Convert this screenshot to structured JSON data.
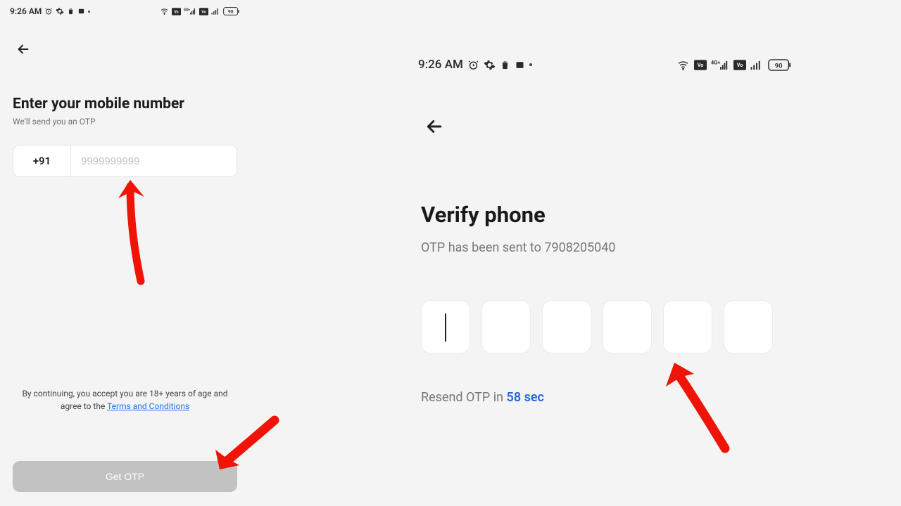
{
  "left": {
    "status": {
      "time": "9:26 AM",
      "battery": "90",
      "icons": [
        "alarm-icon",
        "gear-icon",
        "trash-icon",
        "card-icon",
        "dot"
      ],
      "right_icons": [
        "wifi-icon",
        "volte-icon",
        "signal-4g-icon",
        "volte-icon-2",
        "signal-icon",
        "battery-icon"
      ]
    },
    "title": "Enter your mobile number",
    "subtitle": "We'll send you an OTP",
    "country_code": "+91",
    "phone_placeholder": "9999999999",
    "terms_prefix": "By continuing, you accept you are 18+ years of age and agree to the ",
    "terms_link": "Terms and Conditions",
    "cta": "Get OTP"
  },
  "right": {
    "status": {
      "time": "9:26 AM",
      "battery": "90",
      "icons": [
        "alarm-icon",
        "gear-icon",
        "trash-icon",
        "card-icon",
        "dot"
      ],
      "right_icons": [
        "wifi-icon",
        "volte-icon",
        "signal-4g-icon",
        "volte-icon-2",
        "signal-icon",
        "battery-icon"
      ]
    },
    "title": "Verify phone",
    "subtitle": "OTP has been sent to 7908205040",
    "resend_prefix": "Resend OTP in  ",
    "resend_timer": "58 sec",
    "otp_count": 6
  },
  "annotations": {
    "color": "#f01308"
  }
}
